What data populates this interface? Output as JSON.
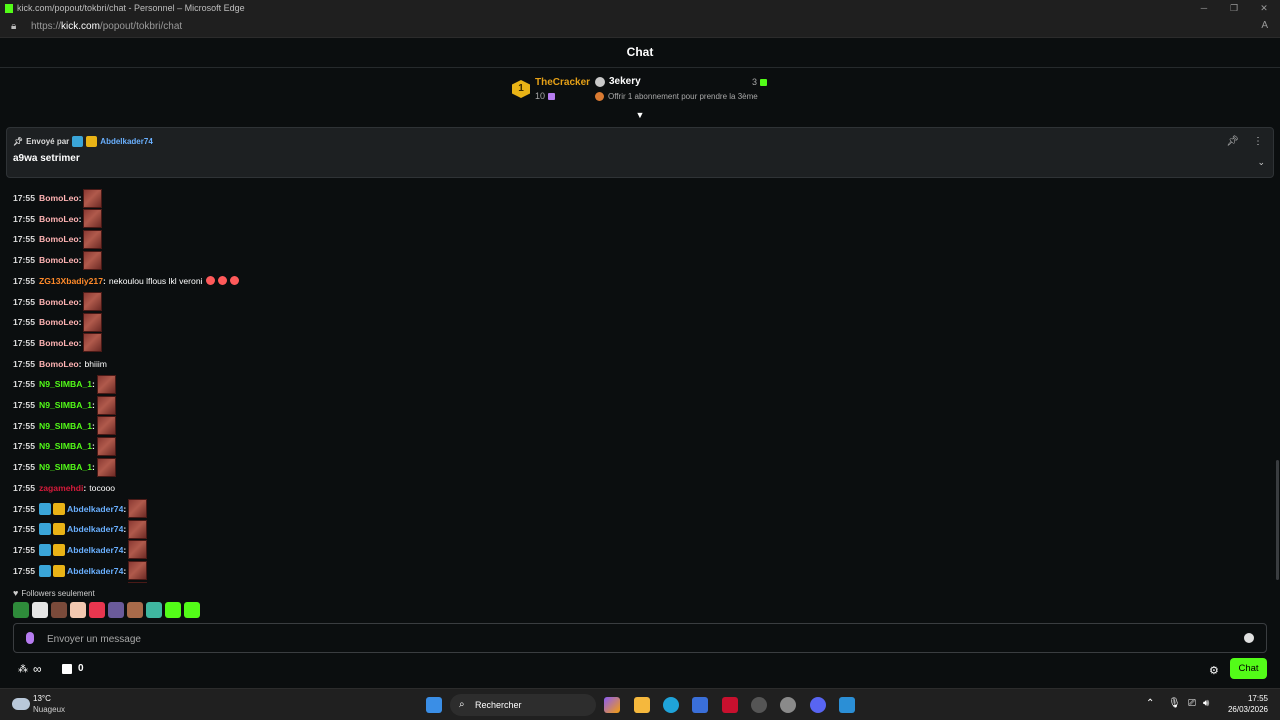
{
  "browser": {
    "window_title": "kick.com/popout/tokbri/chat - Personnel – Microsoft Edge",
    "url_prefix": "https://",
    "url_host": "kick.com",
    "url_path": "/popout/tokbri/chat"
  },
  "chat": {
    "title": "Chat"
  },
  "leaderboard": {
    "top_rank": "1",
    "top_gifter_name": "TheCracker",
    "top_gifter_count": "10",
    "second_user_name": "3ekery",
    "second_user_count": "3",
    "offer_text": "Offrir 1 abonnement pour prendre la 3ème"
  },
  "pinned": {
    "sent_by_label": "Envoyé par",
    "sender": "Abdelkader74",
    "message": "a9wa setrimer"
  },
  "messages": [
    {
      "time": "17:55",
      "user": "BomoLeo",
      "color": "pink",
      "text": "",
      "emotes": 1,
      "badges": false
    },
    {
      "time": "17:55",
      "user": "BomoLeo",
      "color": "pink",
      "text": "",
      "emotes": 1,
      "badges": false
    },
    {
      "time": "17:55",
      "user": "BomoLeo",
      "color": "pink",
      "text": "",
      "emotes": 1,
      "badges": false
    },
    {
      "time": "17:55",
      "user": "BomoLeo",
      "color": "pink",
      "text": "",
      "emotes": 1,
      "badges": false
    },
    {
      "time": "17:55",
      "user": "ZG13Xbadiy217",
      "color": "orange",
      "text": "nekoulou lflous lkl veroni",
      "emotes": 0,
      "smileys": 3,
      "badges": false
    },
    {
      "time": "17:55",
      "user": "BomoLeo",
      "color": "pink",
      "text": "",
      "emotes": 1,
      "badges": false
    },
    {
      "time": "17:55",
      "user": "BomoLeo",
      "color": "pink",
      "text": "",
      "emotes": 1,
      "badges": false
    },
    {
      "time": "17:55",
      "user": "BomoLeo",
      "color": "pink",
      "text": "",
      "emotes": 1,
      "badges": false
    },
    {
      "time": "17:55",
      "user": "BomoLeo",
      "color": "pink",
      "text": "bhiiim",
      "emotes": 0,
      "badges": false
    },
    {
      "time": "17:55",
      "user": "N9_SIMBA_1",
      "color": "green",
      "text": "",
      "emotes": 1,
      "badges": false
    },
    {
      "time": "17:55",
      "user": "N9_SIMBA_1",
      "color": "green",
      "text": "",
      "emotes": 1,
      "badges": false
    },
    {
      "time": "17:55",
      "user": "N9_SIMBA_1",
      "color": "green",
      "text": "",
      "emotes": 1,
      "badges": false
    },
    {
      "time": "17:55",
      "user": "N9_SIMBA_1",
      "color": "green",
      "text": "",
      "emotes": 1,
      "badges": false
    },
    {
      "time": "17:55",
      "user": "N9_SIMBA_1",
      "color": "green",
      "text": "",
      "emotes": 1,
      "badges": false
    },
    {
      "time": "17:55",
      "user": "zagamehdi",
      "color": "red",
      "text": "tocooo",
      "emotes": 0,
      "badges": false
    },
    {
      "time": "17:55",
      "user": "Abdelkader74",
      "color": "blue",
      "text": "",
      "emotes": 1,
      "badges": true
    },
    {
      "time": "17:55",
      "user": "Abdelkader74",
      "color": "blue",
      "text": "",
      "emotes": 1,
      "badges": true
    },
    {
      "time": "17:55",
      "user": "Abdelkader74",
      "color": "blue",
      "text": "",
      "emotes": 1,
      "badges": true
    },
    {
      "time": "17:55",
      "user": "Abdelkader74",
      "color": "blue",
      "text": "",
      "emotes": 1,
      "badges": true
    },
    {
      "time": "17:55",
      "user": "Abdelkader74",
      "color": "blue",
      "text": "",
      "emotes": 1,
      "badges": true
    }
  ],
  "followers_mode": "Followers seulement",
  "emote_bar": [
    "#2e8b3a",
    "#e6e6e6",
    "#7a4a3a",
    "#f2c8b0",
    "#e8364f",
    "#6a5a9a",
    "#a86a4a",
    "#3fb6a0",
    "#53fc18",
    "#53fc18"
  ],
  "input": {
    "placeholder": "Envoyer un message"
  },
  "bottom": {
    "store_count": "0",
    "chat_button": "Chat"
  },
  "taskbar": {
    "temperature": "13°C",
    "weather": "Nuageux",
    "search_label": "Rechercher",
    "time": "17:55",
    "date": "26/03/2026"
  },
  "colors": {
    "kick_green": "#53fc18",
    "pink": "#ffb3b3",
    "orange": "#ff8a2a",
    "green": "#53fc18",
    "red": "#d41a3a",
    "blue": "#6ab0ff"
  }
}
